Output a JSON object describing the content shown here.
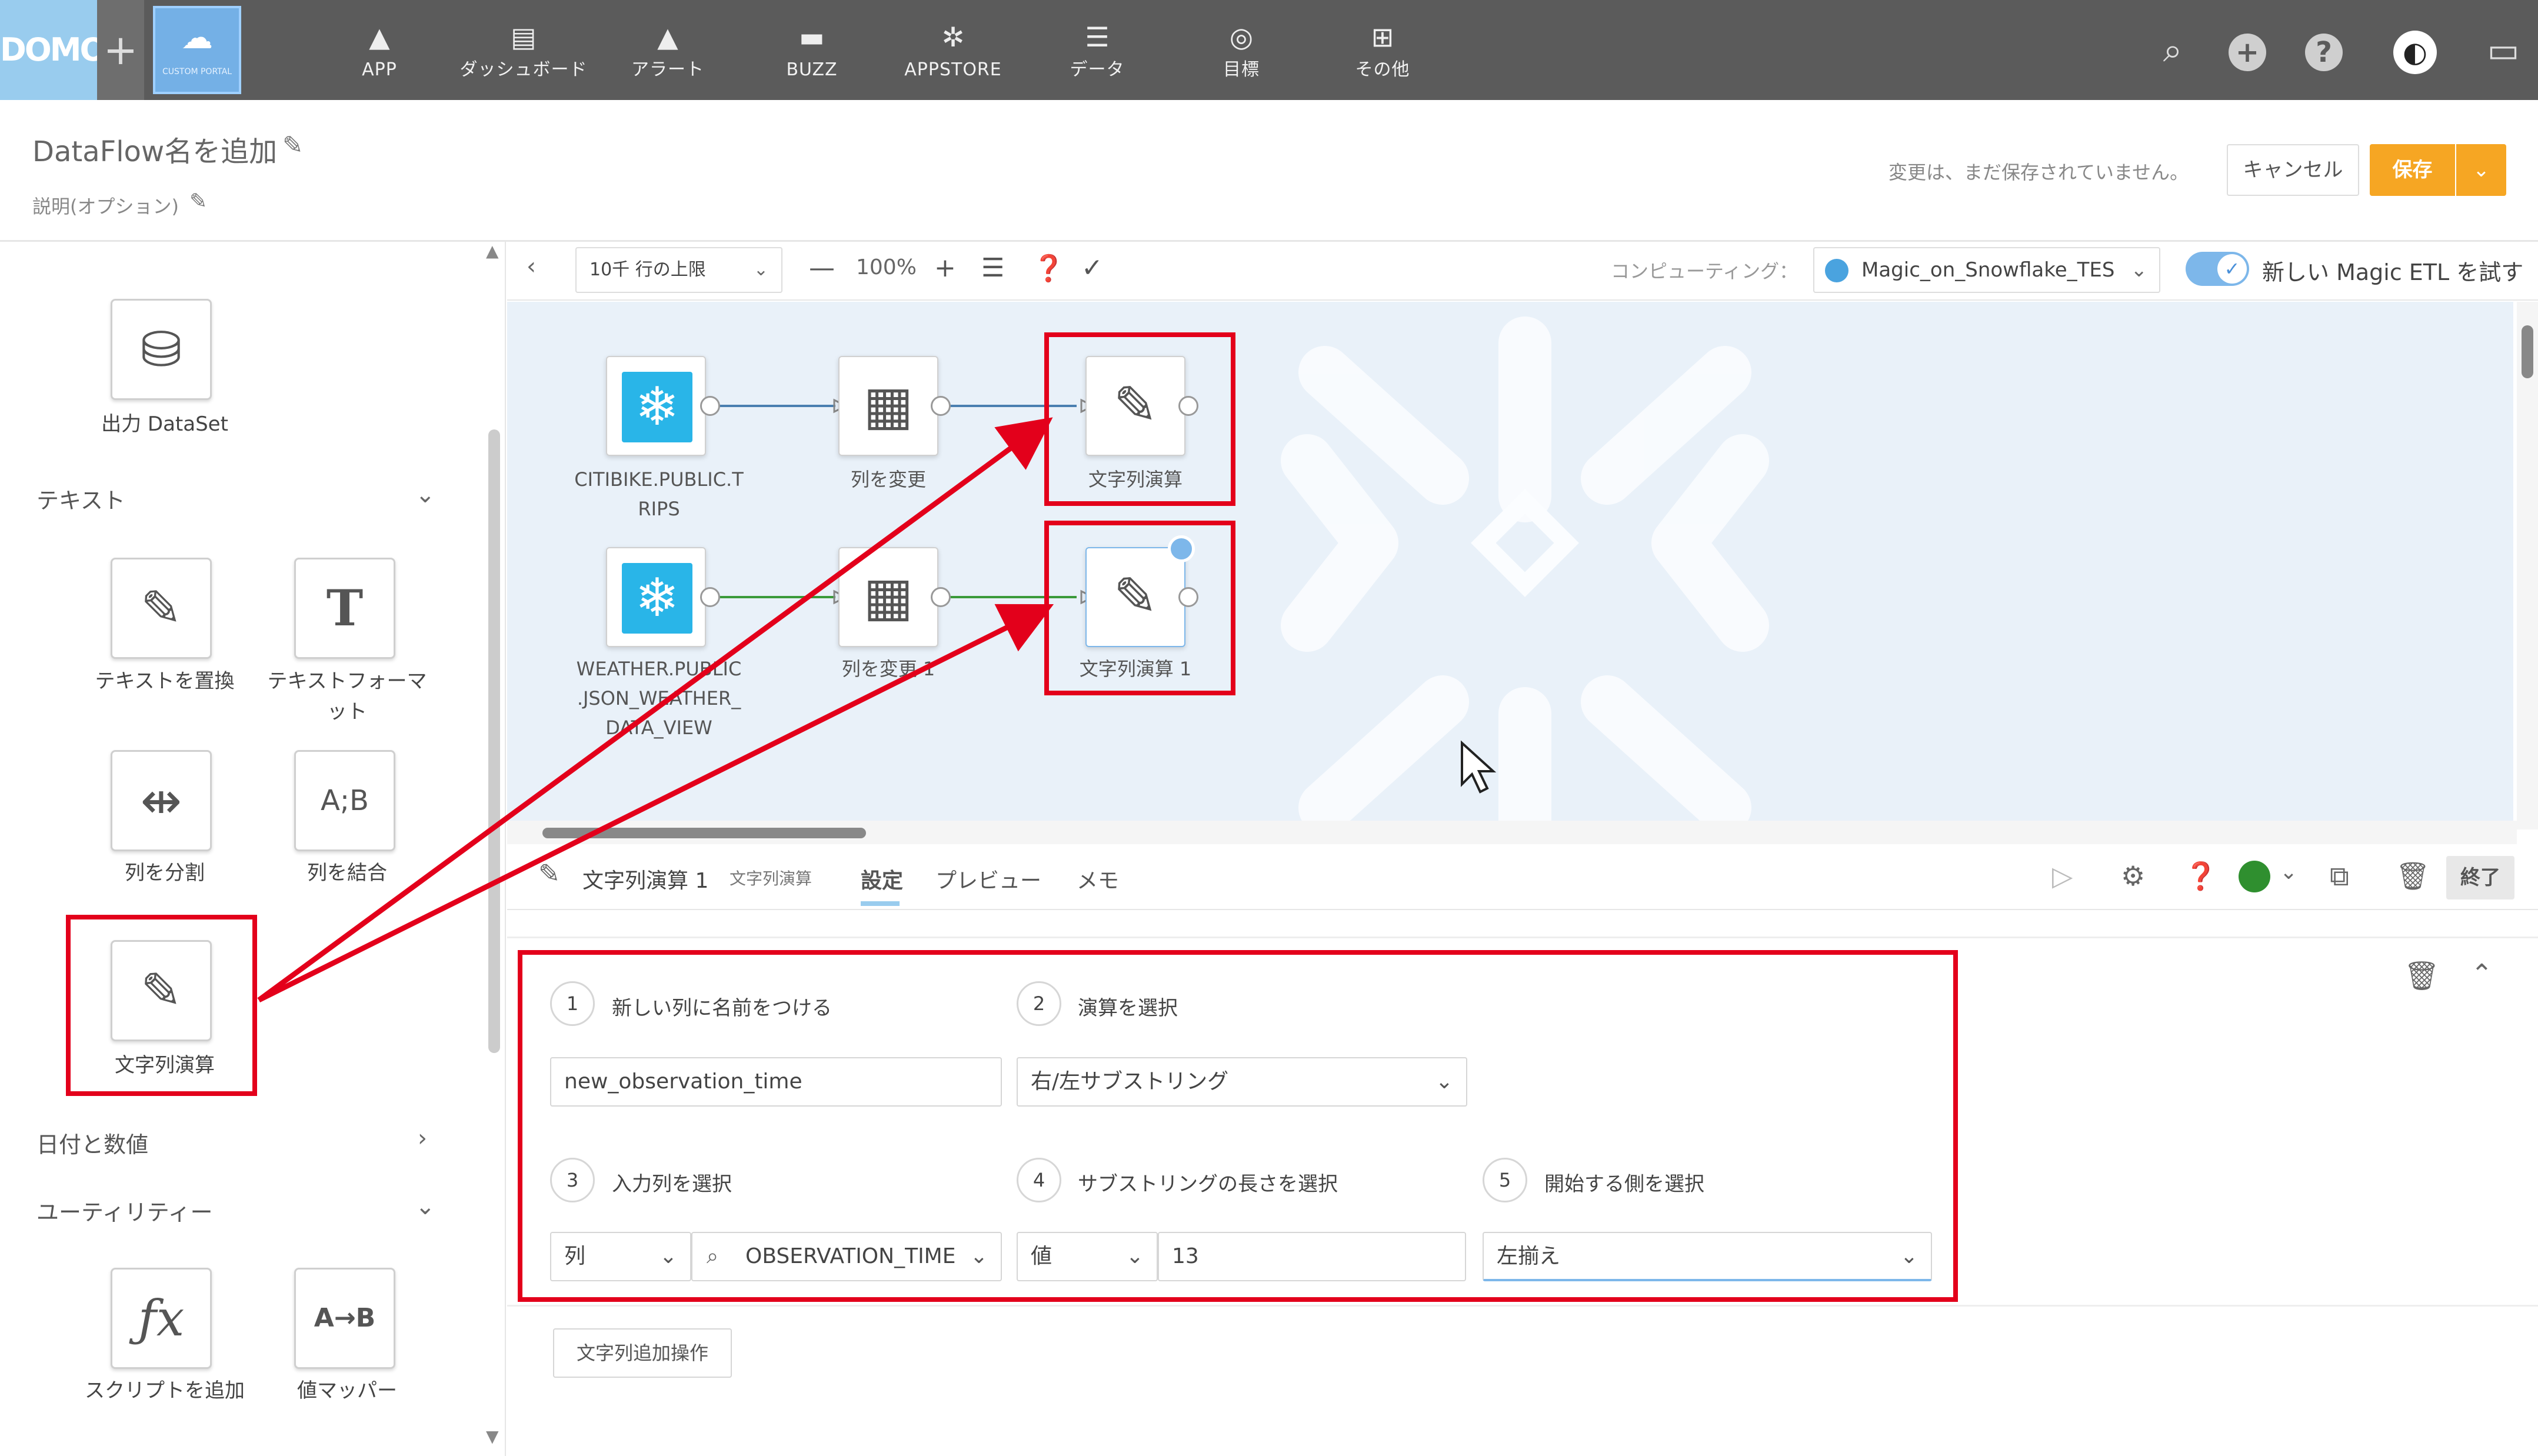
{
  "nav": {
    "logo": "DOMO",
    "plus": "+",
    "portal_label": "CUSTOM PORTAL",
    "items": [
      {
        "label": "APP",
        "icon": "rocket-icon"
      },
      {
        "label": "ダッシュボード",
        "icon": "dashboard-icon"
      },
      {
        "label": "アラート",
        "icon": "bell-icon"
      },
      {
        "label": "BUZZ",
        "icon": "chat-icon"
      },
      {
        "label": "APPSTORE",
        "icon": "appstore-icon"
      },
      {
        "label": "データ",
        "icon": "database-icon"
      },
      {
        "label": "目標",
        "icon": "target-icon"
      },
      {
        "label": "その他",
        "icon": "grid-icon"
      }
    ]
  },
  "header": {
    "title": "DataFlow名を追加",
    "description": "説明(オプション)",
    "unsaved": "変更は、まだ保存されていません。",
    "cancel": "キャンセル",
    "save": "保存"
  },
  "palette": {
    "output_tile": "出力 DataSet",
    "section_text": "テキスト",
    "tiles_text": [
      "テキストを置換",
      "テキストフォーマット",
      "列を分割",
      "列を結合",
      "文字列演算"
    ],
    "tile_glyph_format": "T",
    "tile_glyph_combine": "A;B",
    "section_date": "日付と数値",
    "section_utility": "ユーティリティー",
    "tiles_utility": [
      "スクリプトを追加",
      "値マッパー"
    ],
    "tile_glyph_mapper": "A→B"
  },
  "toolbar": {
    "row_limit": "10千 行の上限",
    "zoom_minus": "—",
    "zoom": "100%",
    "zoom_plus": "+",
    "computing_label": "コンピューティング：",
    "computing_value": "Magic_on_Snowflake_TES",
    "try_label": "新しい Magic ETL を試す"
  },
  "canvas": {
    "nodes": [
      {
        "label": "CITIBIKE.PUBLIC.TRIPS",
        "type": "snowflake"
      },
      {
        "label": "列を変更",
        "type": "alter"
      },
      {
        "label": "文字列演算",
        "type": "string"
      },
      {
        "label": "WEATHER.PUBLIC.JSON_WEATHER_DATA_VIEW",
        "type": "snowflake"
      },
      {
        "label": "列を変更 1",
        "type": "alter"
      },
      {
        "label": "文字列演算 1",
        "type": "string"
      }
    ],
    "node_lines": {
      "citibike": [
        "CITIBIKE.PUBLIC.T",
        "RIPS"
      ],
      "weather": [
        "WEATHER.PUBLIC",
        ".JSON_WEATHER_",
        "DATA_VIEW"
      ]
    }
  },
  "tilebar": {
    "name": "文字列演算 1",
    "sub": "文字列演算",
    "tabs": [
      "設定",
      "プレビュー",
      "メモ"
    ],
    "done": "終了"
  },
  "form": {
    "step1_label": "新しい列に名前をつける",
    "step1_value": "new_observation_time",
    "step2_label": "演算を選択",
    "step2_value": "右/左サブストリング",
    "step3_label": "入力列を選択",
    "step3_type": "列",
    "step3_value": "OBSERVATION_TIME",
    "step4_label": "サブストリングの長さを選択",
    "step4_type": "値",
    "step4_value": "13",
    "step5_label": "開始する側を選択",
    "step5_value": "左揃え",
    "add_op": "文字列追加操作",
    "steps": [
      "1",
      "2",
      "3",
      "4",
      "5"
    ]
  },
  "colors": {
    "nav_bg": "#5b5b5b",
    "accent_orange": "#f6a623",
    "snowflake_blue": "#29b5e8",
    "highlight_red": "#e3001b",
    "canvas_bg": "#e9f1f9",
    "status_green": "#2f8f2f"
  }
}
